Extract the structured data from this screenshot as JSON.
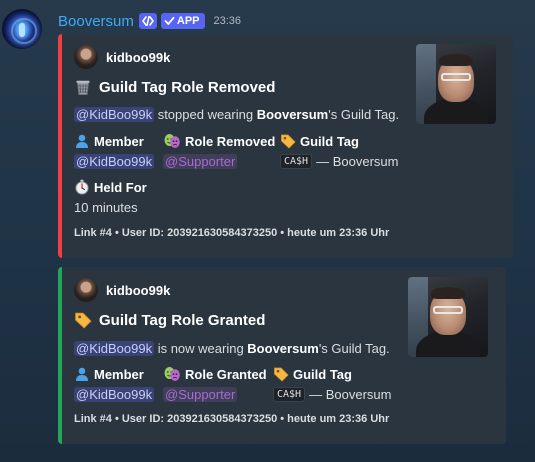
{
  "header": {
    "username": "Booversum",
    "app_tag": "APP",
    "timestamp": "23:36"
  },
  "embeds": [
    {
      "bar_color": "#f23f43",
      "author": "kidboo99k",
      "title": "Guild Tag Role Removed",
      "title_icon": "wastebasket-icon",
      "description": {
        "mention": "@KidBoo99k",
        "text_before": " stopped wearing ",
        "server": "Booversum",
        "text_after": "'s Guild Tag."
      },
      "fields": [
        {
          "name": "Member",
          "icon": "person-icon",
          "value": "@KidBoo99k"
        },
        {
          "name": "Role Removed",
          "icon": "masks-icon",
          "value": "@Supporter"
        },
        {
          "name": "Guild Tag",
          "icon": "label-icon",
          "code": "CA$H",
          "value": "— Booversum"
        },
        {
          "name": "Held For",
          "icon": "stopwatch-icon",
          "value": "10 minutes"
        }
      ],
      "footer": "Link #4 • User ID: 203921630584373250 • heute um 23:36 Uhr"
    },
    {
      "bar_color": "#23a55a",
      "author": "kidboo99k",
      "title": "Guild Tag Role Granted",
      "title_icon": "label-icon",
      "description": {
        "mention": "@KidBoo99k",
        "text_before": " is now wearing ",
        "server": "Booversum",
        "text_after": "'s Guild Tag."
      },
      "fields": [
        {
          "name": "Member",
          "icon": "person-icon",
          "value": "@KidBoo99k"
        },
        {
          "name": "Role Granted",
          "icon": "masks-icon",
          "value": "@Supporter"
        },
        {
          "name": "Guild Tag",
          "icon": "label-icon",
          "code": "CA$H",
          "value": "— Booversum"
        }
      ],
      "footer": "Link #4 • User ID: 203921630584373250 • heute um 23:36 Uhr"
    }
  ]
}
